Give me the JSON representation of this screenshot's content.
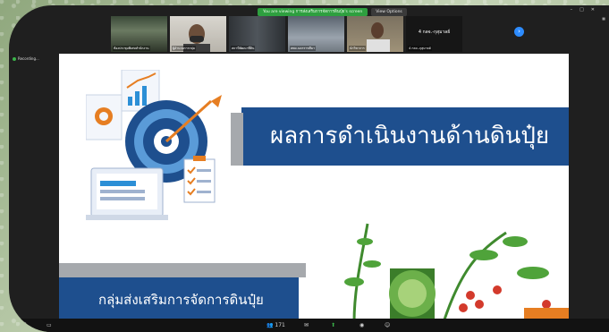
{
  "banner": {
    "viewing_text": "You are viewing การส่งเสริมการจัดการดินปุ๋ย's screen",
    "view_options": "View Options"
  },
  "participants": [
    {
      "name": "ห้องประชุมพิเศษสำนักงาน"
    },
    {
      "name": "ผู้อำนวยการกลุ่ม"
    },
    {
      "name": "สถานีพัฒนาที่ดิน"
    },
    {
      "name": "สพด.นครราชสีมา"
    },
    {
      "name": "นักวิชาการ"
    },
    {
      "name": "4 กลจ.-กุสุมาลย์",
      "label": "4 กลจ.-กุสุมาลย์"
    }
  ],
  "recording_label": "Recording...",
  "slide": {
    "title": "ผลการดำเนินงานด้านดินปุ๋ย",
    "subtitle": "กลุ่มส่งเสริมการจัดการดินปุ๋ย"
  },
  "toolbar": {
    "mic": "●",
    "video": "■",
    "participants_count": "171"
  },
  "colors": {
    "slide_accent": "#1e4f8e",
    "zoom_blue": "#2d8cff",
    "green": "#2e9f3f"
  }
}
